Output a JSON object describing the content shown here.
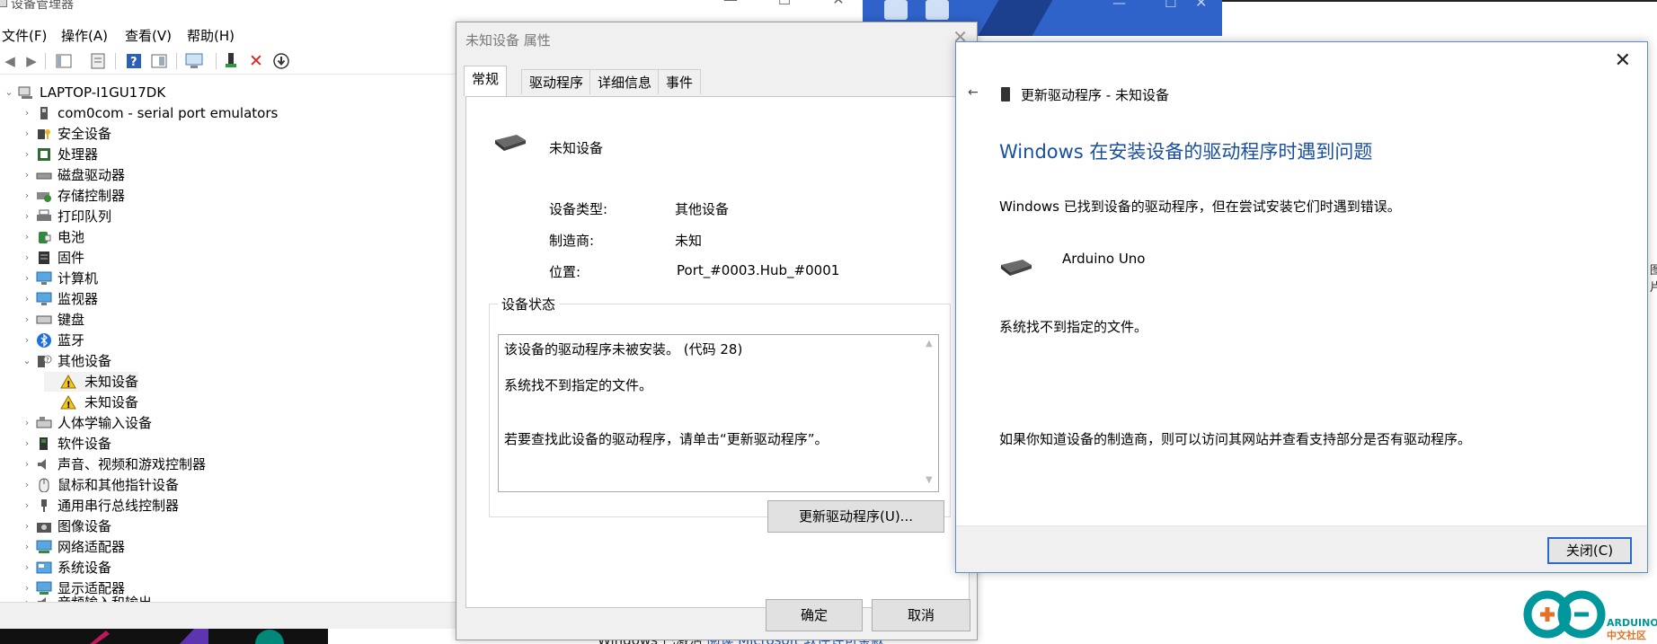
{
  "device_manager": {
    "window_title": "设备管理器",
    "menu": [
      "文件(F)",
      "操作(A)",
      "查看(V)",
      "帮助(H)"
    ],
    "toolbar_icons": [
      "back-arrow-icon",
      "forward-arrow-icon",
      "show-hide-tree-icon",
      "properties-icon",
      "help-icon",
      "action-pane-icon",
      "scan-hardware-icon",
      "update-driver-icon",
      "uninstall-icon",
      "disable-device-icon"
    ],
    "computer_name": "LAPTOP-I1GU17DK",
    "tree_items": [
      "com0com - serial port emulators",
      "安全设备",
      "处理器",
      "磁盘驱动器",
      "存储控制器",
      "打印队列",
      "电池",
      "固件",
      "计算机",
      "监视器",
      "键盘",
      "蓝牙",
      "其他设备",
      "未知设备",
      "未知设备",
      "人体学输入设备",
      "软件设备",
      "声音、视频和游戏控制器",
      "鼠标和其他指针设备",
      "通用串行总线控制器",
      "图像设备",
      "网络适配器",
      "系统设备",
      "显示适配器",
      "音频输入和输出"
    ]
  },
  "properties_dialog": {
    "title": "未知设备 属性",
    "tabs": [
      "常规",
      "驱动程序",
      "详细信息",
      "事件"
    ],
    "device_name": "未知设备",
    "device_type_label": "设备类型:",
    "device_type_value": "其他设备",
    "manufacturer_label": "制造商:",
    "manufacturer_value": "未知",
    "location_label": "位置:",
    "location_value": "Port_#0003.Hub_#0001",
    "status_group_label": "设备状态",
    "status_line1": "该设备的驱动程序未被安装。 (代码 28)",
    "status_line2": "系统找不到指定的文件。",
    "status_line3": "若要查找此设备的驱动程序，请单击“更新驱动程序”。",
    "update_button": "更新驱动程序(U)...",
    "ok_button": "确定",
    "cancel_button": "取消"
  },
  "update_driver": {
    "header": "更新驱动程序 - 未知设备",
    "heading": "Windows 在安装设备的驱动程序时遇到问题",
    "description": "Windows 已找到设备的驱动程序，但在尝试安装它们时遇到错误。",
    "device_name": "Arduino Uno",
    "error_text": "系统找不到指定的文件。",
    "hint": "如果你知道设备的制造商，则可以访问其网站并查看支持部分是否有驱动程序。",
    "close_button": "关闭(C)"
  },
  "background": {
    "activation_text": "Windows 已激活",
    "activation_link": "阅读 Microsoft 软件许可条款",
    "logo_text_top": "ARDUINO",
    "logo_text_bottom": "中文社区",
    "right_edge_text": "图片"
  },
  "colors": {
    "heading_blue": "#1a4fa0",
    "dialog_bg": "#f0f0f0",
    "focus_border": "#2a6ad0",
    "uninstall_red": "#e0201a",
    "arduino_teal": "#00979c",
    "arduino_orange": "#e47128"
  }
}
